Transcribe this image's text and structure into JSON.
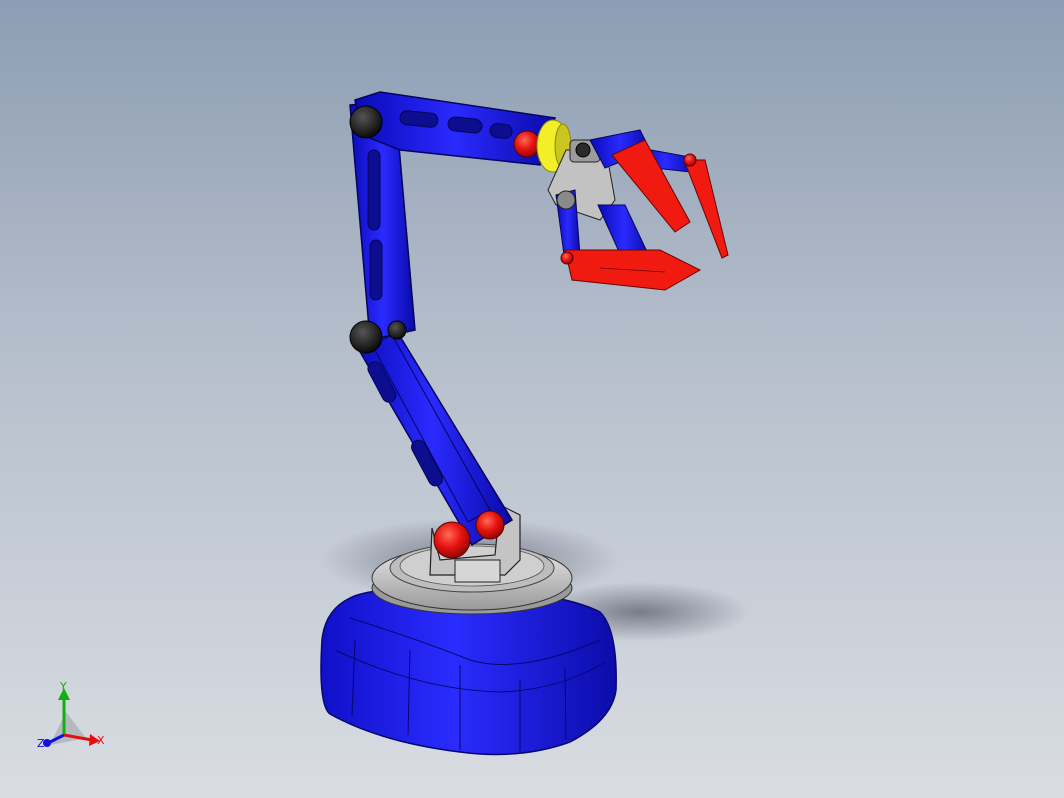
{
  "viewport": {
    "background_top": "#8d9db3",
    "background_bottom": "#d9dde2"
  },
  "model": {
    "colors": {
      "link_blue": "#1d1ff0",
      "link_blue_dark": "#0b0b9a",
      "joint_red": "#e8140f",
      "joint_black": "#111111",
      "wrist_yellow": "#f2ef2a",
      "turntable_gray": "#c8c8c8"
    }
  },
  "triad": {
    "x_label": "X",
    "y_label": "Y",
    "z_label": "Z",
    "x_color": "#e01010",
    "y_color": "#10b010",
    "z_color": "#1010e0"
  }
}
